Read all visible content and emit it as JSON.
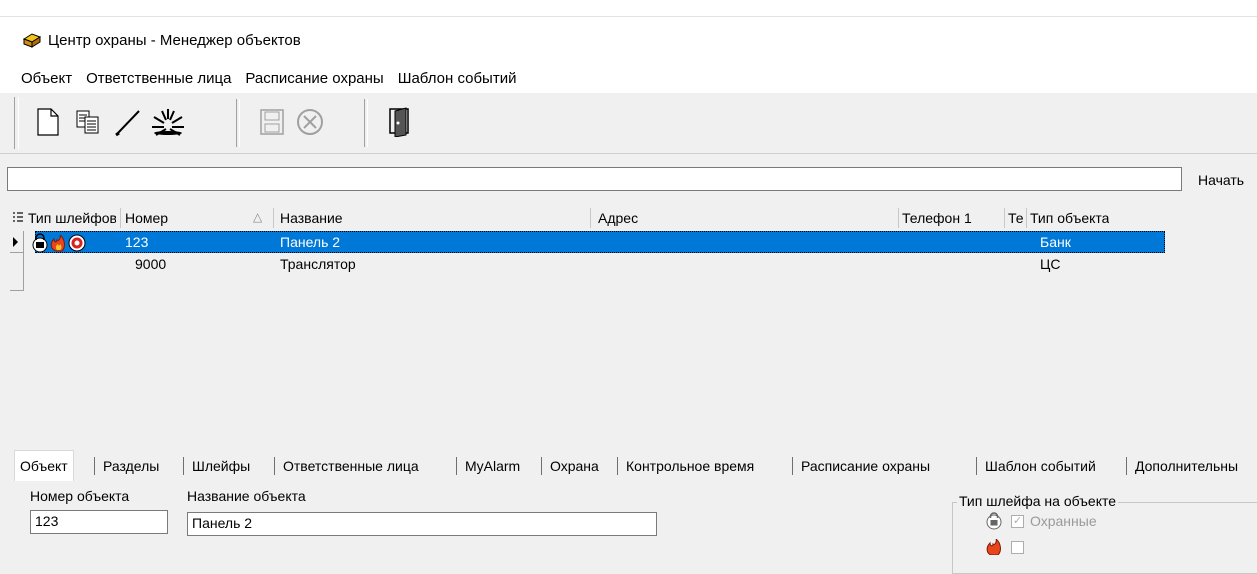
{
  "window": {
    "title": "Центр охраны - Менеджер объектов"
  },
  "menu": [
    "Объект",
    "Ответственные лица",
    "Расписание охраны",
    "Шаблон событий"
  ],
  "search": {
    "value": "",
    "button_label": "Начать"
  },
  "grid": {
    "columns": [
      "Тип шлейфов",
      "Номер",
      "Название",
      "Адрес",
      "Телефон 1",
      "Те",
      "Тип объекта"
    ],
    "rows": [
      {
        "number": "123",
        "name": "Панель 2",
        "address": "",
        "phone1": "",
        "phone2": "",
        "type": "Банк",
        "selected": true
      },
      {
        "number": "9000",
        "name": "Транслятор",
        "address": "",
        "phone1": "",
        "phone2": "",
        "type": "ЦС",
        "selected": false
      }
    ]
  },
  "tabs": [
    "Объект",
    "Разделы",
    "Шлейфы",
    "Ответственные лица",
    "MyAlarm",
    "Охрана",
    "Контрольное время",
    "Расписание охраны",
    "Шаблон событий",
    "Дополнительны"
  ],
  "form": {
    "number_label": "Номер объекта",
    "number_value": "123",
    "name_label": "Название объекта",
    "name_value": "Панель 2",
    "group_title": "Тип шлейфа на объекте",
    "checkbox_security_label": "Охранные"
  }
}
